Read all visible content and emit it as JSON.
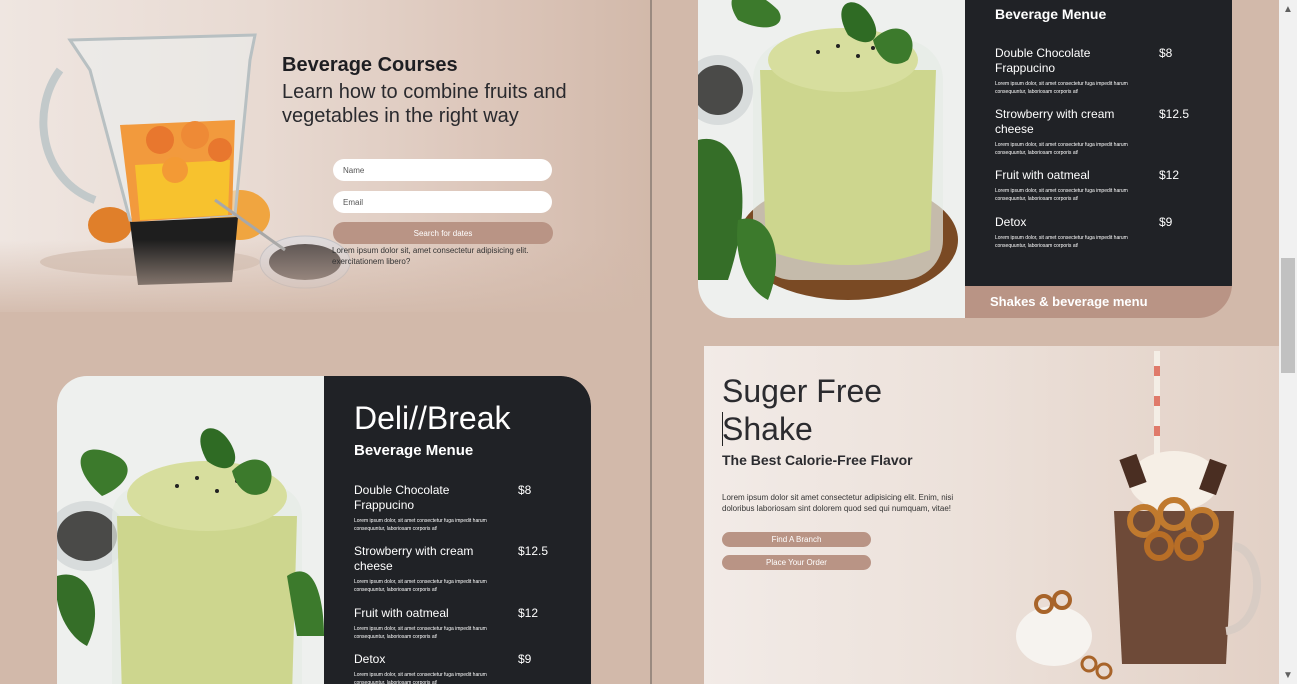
{
  "hero": {
    "title": "Beverage Courses",
    "subtitle": "Learn how to combine fruits and vegetables in the right way",
    "name_placeholder": "Name",
    "email_placeholder": "Email",
    "search_button": "Search for dates",
    "note": "Lorem ipsum dolor sit, amet consectetur adipisicing elit. exercitationem libero?"
  },
  "menu_card_left": {
    "brand": "Deli//Break",
    "heading": "Beverage Menue",
    "items": [
      {
        "name": "Double Chocolate Frappucino",
        "price": "$8",
        "desc": "Lorem ipsum dolor, sit amet consectetur fuga impedit harum consequuntur, laboriosam corporis at!"
      },
      {
        "name": "Strowberry with cream cheese",
        "price": "$12.5",
        "desc": "Lorem ipsum dolor, sit amet consectetur fuga impedit harum consequuntur, laboriosam corporis at!"
      },
      {
        "name": "Fruit with oatmeal",
        "price": "$12",
        "desc": "Lorem ipsum dolor, sit amet consectetur fuga impedit harum consequuntur, laboriosam corporis at!"
      },
      {
        "name": "Detox",
        "price": "$9",
        "desc": "Lorem ipsum dolor, sit amet consectetur fuga impedit harum consequuntur, laboriosam corporis at!"
      }
    ]
  },
  "menu_card_right": {
    "heading": "Beverage Menue",
    "footer": "Shakes & beverage menu",
    "items": [
      {
        "name": "Double Chocolate Frappucino",
        "price": "$8",
        "desc": "Lorem ipsum dolor, sit amet consectetur fuga impedit harum consequuntur, laboriosam corporis at!"
      },
      {
        "name": "Strowberry with cream cheese",
        "price": "$12.5",
        "desc": "Lorem ipsum dolor, sit amet consectetur fuga impedit harum consequuntur, laboriosam corporis at!"
      },
      {
        "name": "Fruit with oatmeal",
        "price": "$12",
        "desc": "Lorem ipsum dolor, sit amet consectetur fuga impedit harum consequuntur, laboriosam corporis at!"
      },
      {
        "name": "Detox",
        "price": "$9",
        "desc": "Lorem ipsum dolor, sit amet consectetur fuga impedit harum consequuntur, laboriosam corporis at!"
      }
    ]
  },
  "shake": {
    "title_line1": "Suger Free",
    "title_line2": "Shake",
    "subtitle": "The Best Calorie-Free Flavor",
    "description": "Lorem ipsum dolor sit amet consectetur adipisicing elit. Enim, nisi doloribus laboriosam sint dolorem quod sed qui numquam, vitae!",
    "button_branch": "Find A Branch",
    "button_order": "Place Your Order"
  },
  "scrollbar": {
    "up_icon": "▲",
    "down_icon": "▼"
  },
  "colors": {
    "accent": "#b99485",
    "dark": "#202226",
    "background": "#d2b9aa"
  }
}
